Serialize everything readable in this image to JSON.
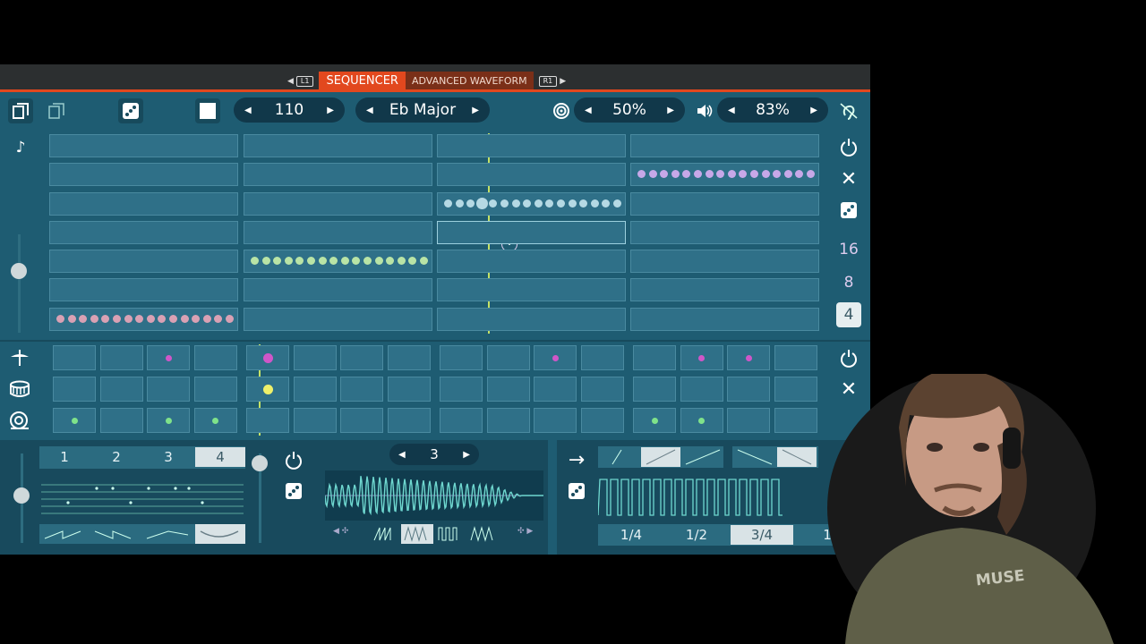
{
  "tabs": {
    "left_key": "L1",
    "active": "SEQUENCER",
    "inactive": "ADVANCED WAVEFORM",
    "right_key": "R1"
  },
  "toolbar": {
    "tempo": "110",
    "scale": "Eb Major",
    "swing": "50%",
    "volume": "83%"
  },
  "step_lengths": [
    "16",
    "8",
    "4"
  ],
  "selected_step_length": "4",
  "bottom": {
    "pattern_tabs": [
      "1",
      "2",
      "3",
      "4"
    ],
    "selected_pattern": "4",
    "octave": "3",
    "rate_options": [
      "1/4",
      "1/2",
      "3/4",
      "1"
    ],
    "selected_rate": "3/4"
  },
  "colors": {
    "accent": "#e2481e",
    "panel": "#1e5c72",
    "cell": "#2f7088",
    "melody_pink": "#d9a1b4",
    "melody_green": "#b9e4a6",
    "melody_blue": "#b5d9e4",
    "melody_purple": "#c7a8e8",
    "drum_magenta": "#d056c8",
    "drum_yellow": "#eef06a",
    "drum_green": "#7fe28a"
  },
  "icons": [
    "copy-icon",
    "paste-icon",
    "dice-icon",
    "stop-icon",
    "target-icon",
    "speaker-icon",
    "ear-icon",
    "note-icon",
    "power-icon",
    "close-icon",
    "cymbal-icon",
    "snare-icon",
    "kick-icon",
    "arrow-right-icon"
  ]
}
